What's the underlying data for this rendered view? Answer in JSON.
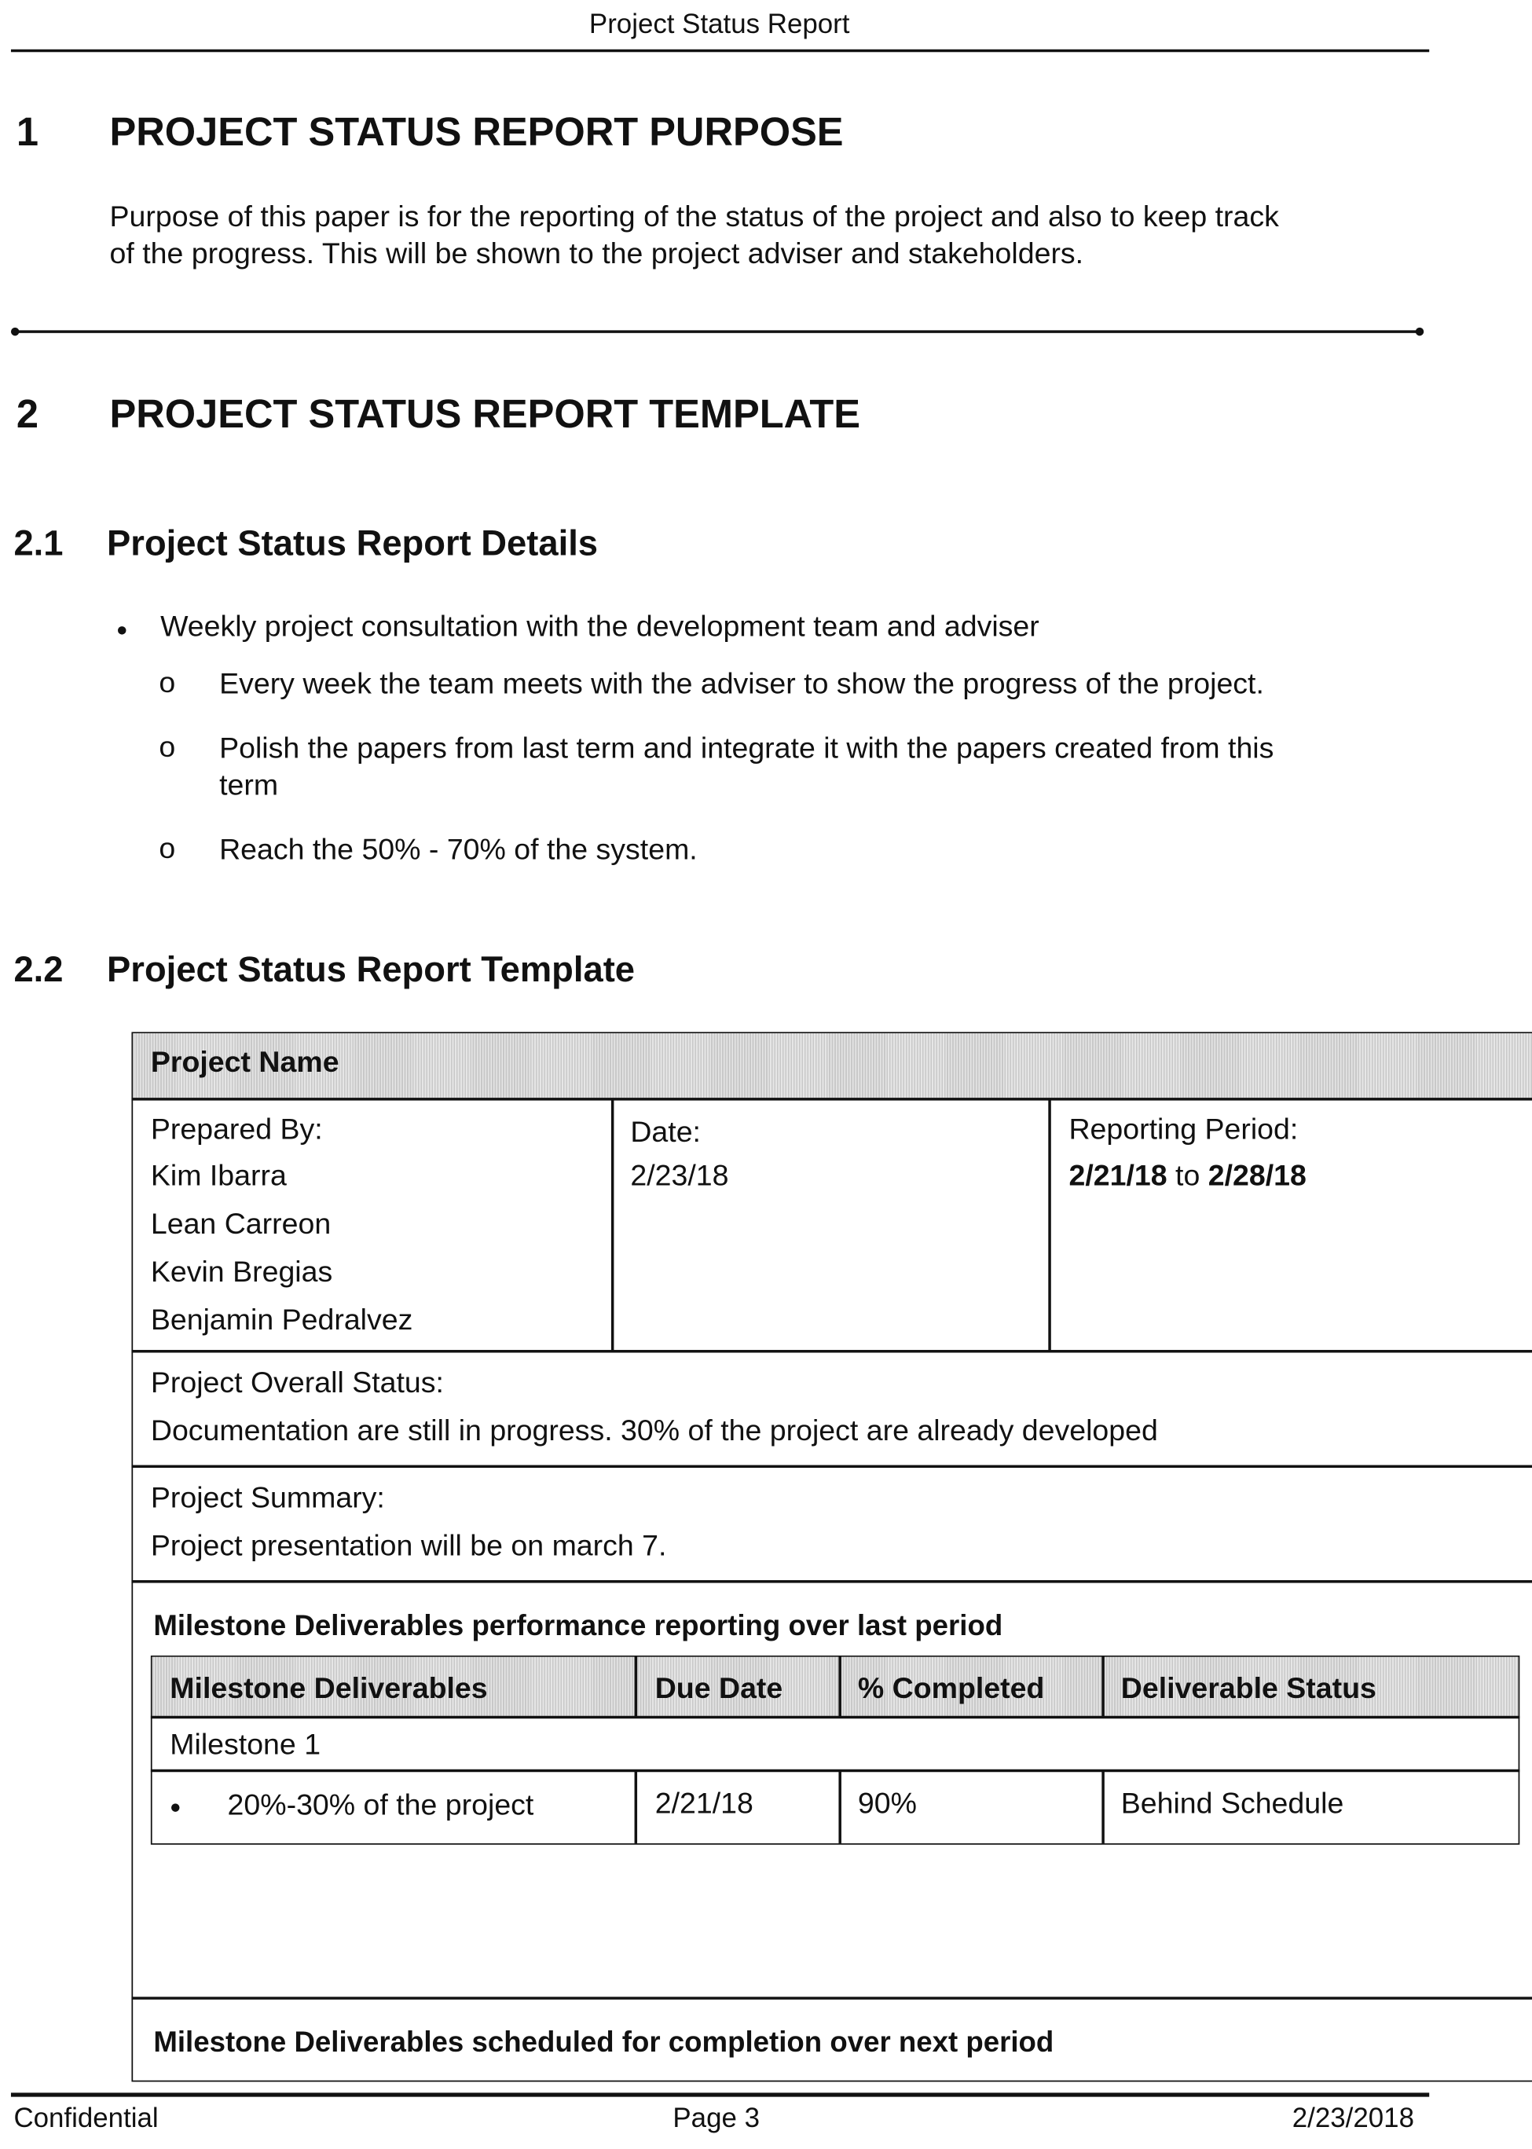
{
  "header": {
    "title": "Project Status Report"
  },
  "section1": {
    "number": "1",
    "title": "PROJECT STATUS REPORT PURPOSE",
    "paragraph_lines": [
      "Purpose of this paper is for the reporting of the status of the project and also to keep track",
      "of the progress. This will be shown to the project adviser and stakeholders."
    ]
  },
  "section2": {
    "number": "2",
    "title": "PROJECT STATUS REPORT TEMPLATE"
  },
  "section2_1": {
    "number": "2.1",
    "title": "Project Status Report Details",
    "bullet": "Weekly project consultation with the development team and adviser",
    "sub_bullets": [
      {
        "marker": "o",
        "lines": [
          "Every week the team meets with the adviser to show the progress of the project."
        ]
      },
      {
        "marker": "o",
        "lines": [
          "Polish the papers from last term and integrate it with the papers created from this",
          "term"
        ]
      },
      {
        "marker": "o",
        "lines": [
          "Reach the 50% - 70% of the system."
        ]
      }
    ]
  },
  "section2_2": {
    "number": "2.2",
    "title": "Project Status Report Template"
  },
  "template": {
    "project_name_label": "Project Name",
    "prepared_by_label": "Prepared By:",
    "prepared_by": [
      "Kim Ibarra",
      "Lean Carreon",
      "Kevin Bregias",
      "Benjamin Pedralvez"
    ],
    "date_label": "Date:",
    "date_value": "2/23/18",
    "reporting_period_label": "Reporting Period:",
    "reporting_period_start": "2/21/18",
    "reporting_period_to": "to",
    "reporting_period_end": "2/28/18",
    "overall_status_label": "Project Overall Status:",
    "overall_status": "Documentation are still in progress. 30% of the project are already developed",
    "summary_label": "Project Summary:",
    "summary": "Project presentation will be on march 7.",
    "last_period_heading": "Milestone Deliverables performance reporting over last period",
    "milestone_table": {
      "headers": [
        "Milestone Deliverables",
        "Due Date",
        "% Completed",
        "Deliverable Status"
      ],
      "group": "Milestone 1",
      "rows": [
        {
          "deliverable": "20%-30% of the project",
          "due_date": "2/21/18",
          "completed": "90%",
          "status": "Behind Schedule"
        }
      ]
    },
    "next_period_heading": "Milestone Deliverables scheduled for completion over next period"
  },
  "footer": {
    "left": "Confidential",
    "center": "Page 3",
    "right": "2/23/2018"
  }
}
